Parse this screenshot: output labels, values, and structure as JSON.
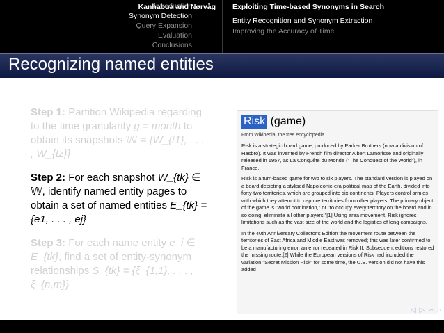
{
  "header": {
    "nav_items": [
      "Introduction",
      "Synonym Detection",
      "Query Expansion",
      "Evaluation",
      "Conclusions"
    ],
    "active_index": 1,
    "title": "Entity Recognition and Synonym Extraction",
    "subtitle": "Improving the Accuracy of Time"
  },
  "frame_title": "Recognizing named entities",
  "steps": [
    {
      "label": "Step 1:",
      "pre": "Partition Wikipedia regarding to the time granularity",
      "math1": "g = month",
      "mid": "to obtain its snapshots",
      "math2": "𝕎 = {W_{t1}, . . . , W_{tz}}"
    },
    {
      "label": "Step 2:",
      "pre": "For each snapshot",
      "math1": "W_{tk} ∈ 𝕎",
      "mid": ", identify named entity pages to obtain a set of named entities",
      "math2": "E_{tk} = {e1, . . . , ej}"
    },
    {
      "label": "Step 3:",
      "pre": "For each name entity",
      "math1": "e_i ∈ E_{tk}",
      "mid": ", find a set of entity-synonym relationships",
      "math2": "S_{tk} = {ξ_{1,1}, . . . , ξ_{n,m}}"
    }
  ],
  "wiki": {
    "title_highlight": "Risk",
    "title_rest": "(game)",
    "from": "From Wikipedia, the free encyclopedia",
    "p1": "Risk is a strategic board game, produced by Parker Brothers (now a division of Hasbro). It was invented by French film director Albert Lamorisse and originally released in 1957, as La Conquête du Monde (\"The Conquest of the World\"), in France.",
    "p2": "Risk is a turn-based game for two to six players. The standard version is played on a board depicting a stylised Napoleonic-era political map of the Earth, divided into forty-two territories, which are grouped into six continents. Players control armies with which they attempt to capture territories from other players. The primary object of the game is \"world domination,\" or \"to occupy every territory on the board and in so doing, eliminate all other players.\"[1] Using area movement, Risk ignores limitations such as the vast size of the world and the logistics of long campaigns.",
    "p3": "In the 40th Anniversary Collector's Edition the movement route between the territories of East Africa and Middle East was removed; this was later confirmed to be a manufacturing error, an error repeated in Risk II. Subsequent editions restored the missing route.[2] While the European versions of Risk had included the variation \"Secret Mission Risk\" for some time, the U.S. version did not have this added"
  },
  "footer": {
    "authors": "Kanhabua and Nørvåg",
    "talk_title": "Exploiting Time-based Synonyms in Search"
  },
  "colors": {
    "nav_active": "#ffffff",
    "nav_inactive": "#8f8f8f",
    "title_bar": "#1c2652",
    "faded_text": "#d2d2d2",
    "wiki_highlight": "#2b62c3"
  }
}
